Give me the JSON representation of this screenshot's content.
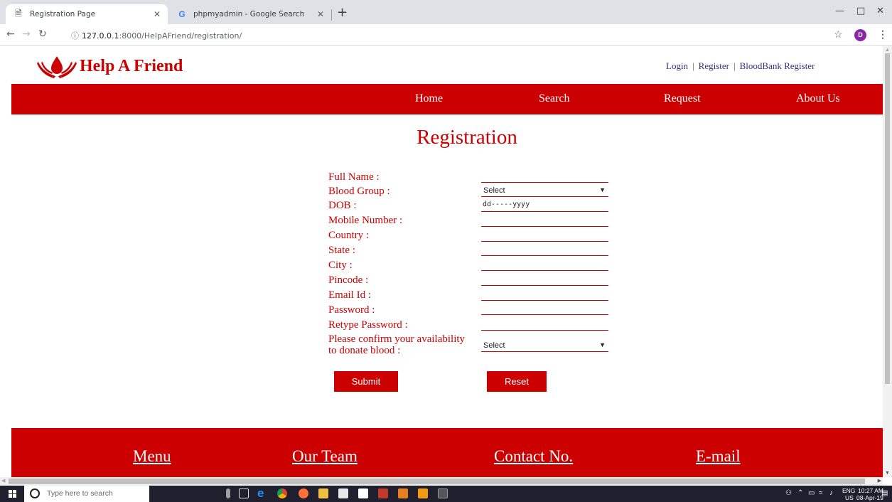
{
  "browser": {
    "tabs": [
      {
        "title": "Registration Page",
        "icon": "page-icon",
        "active": true
      },
      {
        "title": "phpmyadmin - Google Search",
        "icon": "google-icon",
        "active": false
      }
    ],
    "url_host": "127.0.0.1",
    "url_path": ":8000/HelpAFriend/registration/",
    "profile_initial": "D"
  },
  "site": {
    "brand": "Help A Friend",
    "brand_color": "#cc0000",
    "top_links": [
      "Login",
      "Register",
      "BloodBank Register"
    ],
    "nav": [
      "Home",
      "Search",
      "Request",
      "About Us"
    ],
    "title": "Registration"
  },
  "form": {
    "fields": {
      "full_name": {
        "label": "Full Name :",
        "value": ""
      },
      "blood_group": {
        "label": "Blood Group :",
        "value": "Select"
      },
      "dob": {
        "label": "DOB :",
        "value": "dd-----yyyy"
      },
      "mobile": {
        "label": "Mobile Number :",
        "value": ""
      },
      "country": {
        "label": "Country :",
        "value": ""
      },
      "state": {
        "label": "State :",
        "value": ""
      },
      "city": {
        "label": "City :",
        "value": ""
      },
      "pincode": {
        "label": "Pincode :",
        "value": ""
      },
      "email": {
        "label": "Email Id :",
        "value": ""
      },
      "password": {
        "label": "Password :",
        "value": ""
      },
      "retype_password": {
        "label": "Retype Password :",
        "value": ""
      },
      "availability": {
        "label_line1": "Please confirm your availability",
        "label_line2": "to donate blood :",
        "value": "Select"
      }
    },
    "submit_label": "Submit",
    "reset_label": "Reset"
  },
  "footer": [
    "Menu",
    "Our Team",
    "Contact No.",
    "E-mail"
  ],
  "taskbar": {
    "search_placeholder": "Type here to search",
    "lang": "ENG",
    "region": "US",
    "time": "10:27 AM",
    "date": "08-Apr-19"
  }
}
